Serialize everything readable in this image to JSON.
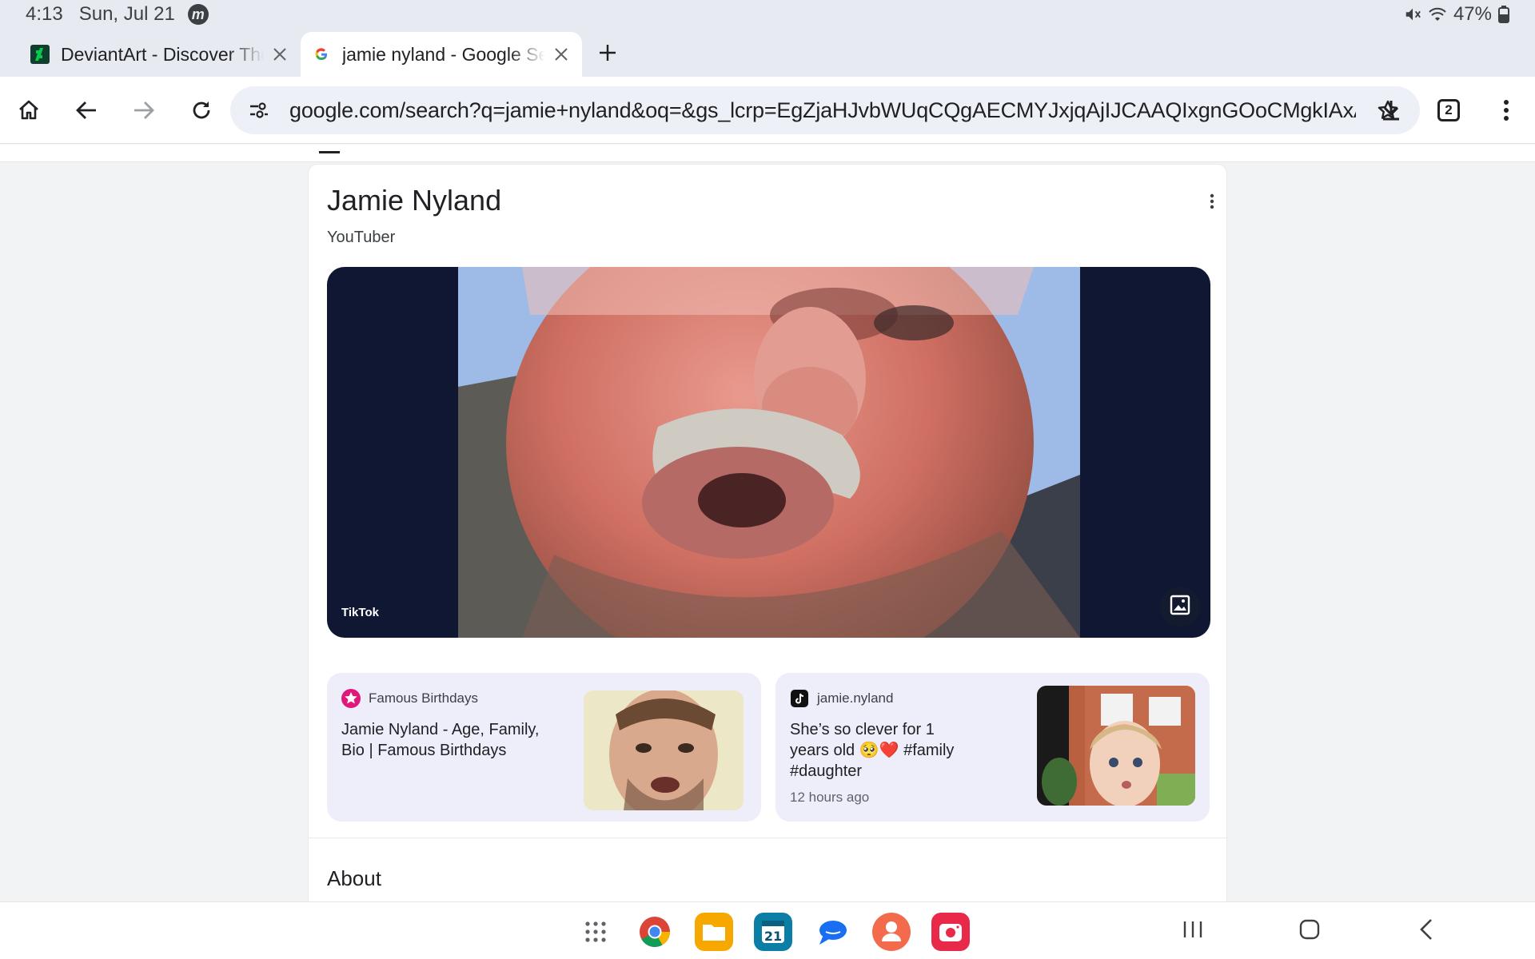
{
  "status_bar": {
    "time": "4:13",
    "date": "Sun, Jul 21",
    "app_badge": "m",
    "battery": "47%"
  },
  "tabs": [
    {
      "title": "DeviantArt - Discover The Largest Online Art Gallery and Community",
      "active": false
    },
    {
      "title": "jamie nyland - Google Search",
      "active": true
    }
  ],
  "toolbar": {
    "url": "google.com/search?q=jamie+nyland&oq=&gs_lcrp=EgZjaHJvbWUqCQgAECMYJxjqAjIJCAAQIxgnGOoCMgkIAxAjGCcY6gIyCQgBECMYJxjqAjIJCAI",
    "tab_count": "2"
  },
  "knowledge_panel": {
    "title": "Jamie Nyland",
    "subtitle": "YouTuber",
    "hero_source": "TikTok",
    "cards": [
      {
        "source": "Famous Birthdays",
        "headline_line1": "Jamie Nyland - Age, Family,",
        "headline_line2": "Bio | Famous Birthdays"
      },
      {
        "source": "jamie.nyland",
        "headline_line1": "She’s so clever for 1",
        "headline_line2": "years old 🥺❤️ #family",
        "headline_line3": "#daughter",
        "time": "12 hours ago"
      }
    ],
    "about_heading": "About"
  },
  "colors": {
    "chrome_bg": "#e7eaf1",
    "omnibox_bg": "#eef0f7",
    "card_tint": "#eeeefb",
    "hero_bg": "#0f1733"
  }
}
